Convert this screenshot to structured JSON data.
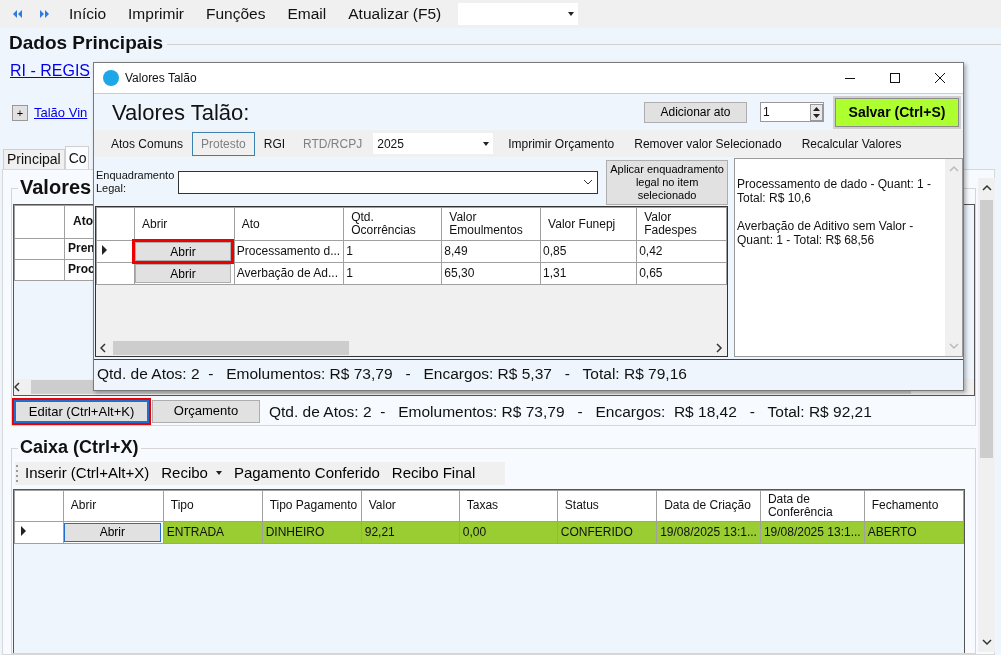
{
  "toolbar": {
    "items": [
      "Início",
      "Imprimir",
      "Funções",
      "Email",
      "Atualizar (F5)"
    ]
  },
  "main": {
    "section_title": "Dados Principais",
    "registry_link": "RI - REGIS",
    "expand_button": "+",
    "linked_link": "Talão Vin",
    "tabs": [
      {
        "label": "Principal",
        "selected": false
      },
      {
        "label": "Co",
        "selected": true
      }
    ],
    "values_group": {
      "title": "Valores",
      "columns": [
        "Ato"
      ],
      "rows": [
        [
          "Pren"
        ],
        [
          "Proc"
        ]
      ],
      "buttons": [
        {
          "label": "Editar (Ctrl+Alt+K)",
          "highlighted": true
        },
        {
          "label": "Orçamento",
          "highlighted": false
        }
      ],
      "summary": "Qtd. de Atos: 2  -   Emolumentos: R$ 73,79   -   Encargos:  R$ 18,42   -   Total: R$ 92,21"
    },
    "cash": {
      "title": "Caixa (Ctrl+X)",
      "toolbar": [
        {
          "label": "Inserir (Ctrl+Alt+X)",
          "kind": "button"
        },
        {
          "label": "Recibo",
          "kind": "dropdown"
        },
        {
          "label": "Pagamento Conferido",
          "kind": "button"
        },
        {
          "label": "Recibo Final",
          "kind": "button"
        }
      ],
      "columns": [
        "Abrir",
        "Tipo",
        "Tipo Pagamento",
        "Valor",
        "Taxas",
        "Status",
        "Data de Criação",
        "Data de Conferência",
        "Fechamento"
      ],
      "rows": [
        {
          "selected": true,
          "color": "#9acd32",
          "cells": [
            "Abrir",
            "ENTRADA",
            "DINHEIRO",
            "92,21",
            "0,00",
            "CONFERIDO",
            "19/08/2025 13:1...",
            "19/08/2025 13:1...",
            "ABERTO"
          ]
        }
      ]
    }
  },
  "dialog": {
    "title": "Valores Talão",
    "heading": "Valores Talão:",
    "add_button": "Adicionar ato",
    "quantity": "1",
    "save_button": "Salvar (Ctrl+S)",
    "tabs": [
      {
        "label": "Atos Comuns",
        "selected": false,
        "disabled": false
      },
      {
        "label": "Protesto",
        "selected": true,
        "disabled": true
      },
      {
        "label": "RGI",
        "selected": false,
        "disabled": false
      },
      {
        "label": "RTD/RCPJ",
        "selected": false,
        "disabled": true
      }
    ],
    "year": "2025",
    "actions": [
      "Imprimir Orçamento",
      "Remover valor Selecionado",
      "Recalcular Valores"
    ],
    "legal_label": "Enquadramento Legal:",
    "apply_button": "Aplicar enquadramento legal no item selecionado",
    "columns": [
      "Abrir",
      "Ato",
      "Qtd. Ocorrências",
      "Valor Emoulmentos",
      "Valor Funepj",
      "Valor Fadespes"
    ],
    "rows": [
      {
        "selected": true,
        "highlighted": true,
        "cells": [
          "Abrir",
          "Processamento d...",
          "1",
          "8,49",
          "0,85",
          "0,42"
        ]
      },
      {
        "selected": false,
        "highlighted": false,
        "cells": [
          "Abrir",
          "Averbação de Ad...",
          "1",
          "65,30",
          "1,31",
          "0,65"
        ]
      }
    ],
    "notes": [
      "Processamento de dado -  Quant: 1 - Total: R$ 10,6",
      "Averbação de Aditivo sem Valor -  Quant: 1 - Total: R$ 68,56"
    ],
    "footer": "Qtd. de Atos: 2  -   Emolumentos: R$ 73,79   -   Encargos: R$ 5,37   -   Total: R$ 79,16"
  }
}
